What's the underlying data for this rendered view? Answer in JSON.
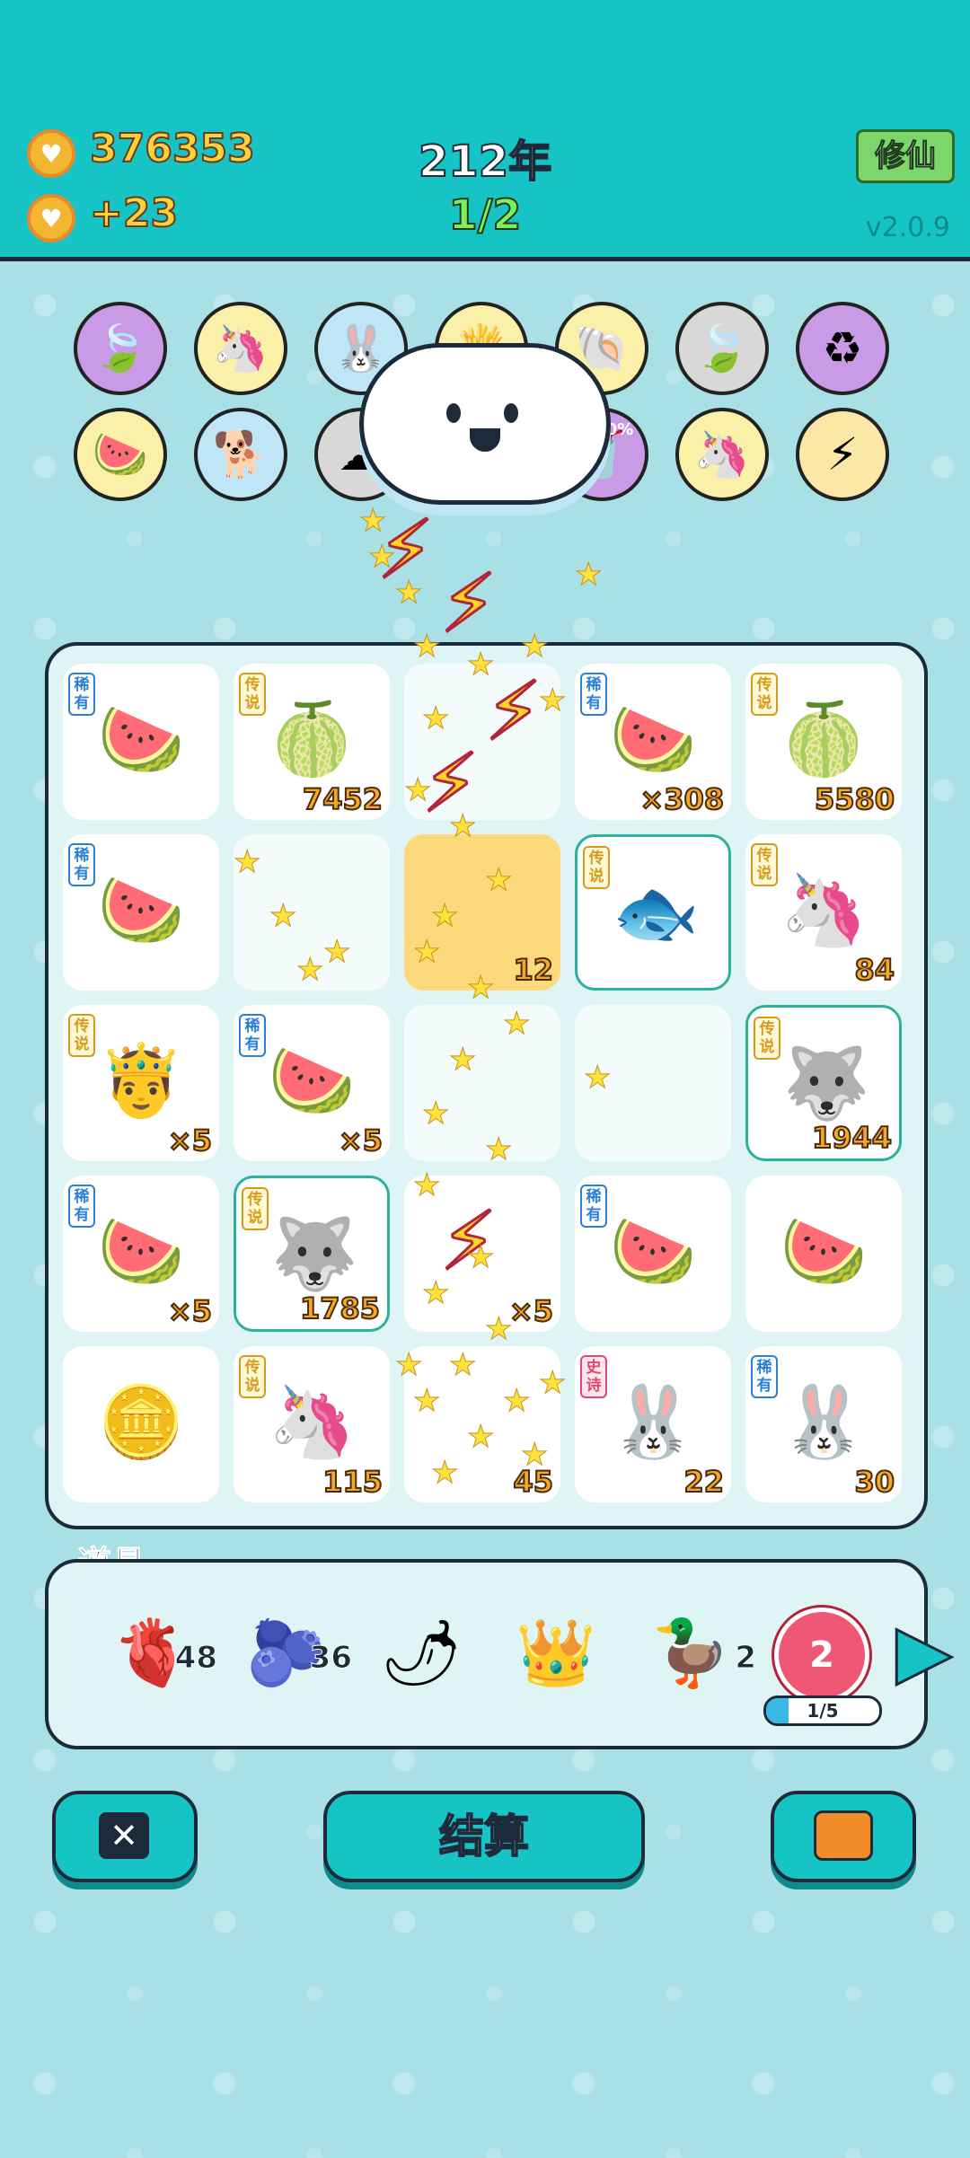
{
  "header": {
    "coins": "376353",
    "coins_rate": "+23",
    "year": "212年",
    "round": "1/2",
    "mode_button": "修仙",
    "version": "v2.0.9"
  },
  "upgrades": [
    {
      "icon": "leaf-icon",
      "glyph": "🍃"
    },
    {
      "icon": "unicorn-icon",
      "glyph": "🦄"
    },
    {
      "icon": "rabbit-icon",
      "glyph": "🐰"
    },
    {
      "icon": "fries-icon",
      "glyph": "🍟"
    },
    {
      "icon": "shell-icon",
      "glyph": "🐚"
    },
    {
      "icon": "leaf-icon",
      "glyph": "🍃"
    },
    {
      "icon": "recycle-icon",
      "glyph": "♻"
    },
    {
      "icon": "fruit-basket-icon",
      "glyph": "🍉"
    },
    {
      "icon": "dog-icon",
      "glyph": "🐕"
    },
    {
      "icon": "cloud-icon",
      "glyph": "☁"
    },
    {
      "icon": "alert-icon",
      "glyph": "⚠"
    },
    {
      "icon": "juice-icon",
      "glyph": "🥤",
      "label": "+100%"
    },
    {
      "icon": "unicorn-icon",
      "glyph": "🦄"
    },
    {
      "icon": "lightning-icon",
      "glyph": "⚡"
    }
  ],
  "board": {
    "cells": [
      {
        "tag": "稀有",
        "tagColor": "blue",
        "glyph": "🍉",
        "icon": "watermelon-slice-icon",
        "count": ""
      },
      {
        "tag": "传说",
        "tagColor": "gold",
        "glyph": "🍈",
        "icon": "watermelon-icon",
        "count": "7452"
      },
      {
        "tag": "",
        "tagColor": "",
        "glyph": "",
        "icon": "",
        "count": ""
      },
      {
        "tag": "稀有",
        "tagColor": "blue",
        "glyph": "🍉",
        "icon": "watermelon-slice-icon",
        "count": "×308"
      },
      {
        "tag": "传说",
        "tagColor": "gold",
        "glyph": "🍈",
        "icon": "watermelon-icon",
        "count": "5580"
      },
      {
        "tag": "稀有",
        "tagColor": "blue",
        "glyph": "🍉",
        "icon": "watermelon-slice-icon",
        "count": ""
      },
      {
        "tag": "",
        "tagColor": "",
        "glyph": "",
        "icon": "",
        "count": ""
      },
      {
        "tag": "",
        "tagColor": "",
        "glyph": "",
        "icon": "",
        "count": "12",
        "gold": true
      },
      {
        "tag": "传说",
        "tagColor": "gold",
        "glyph": "🐟",
        "icon": "koi-fish-icon",
        "count": "",
        "hl": true
      },
      {
        "tag": "传说",
        "tagColor": "gold",
        "glyph": "🦄",
        "icon": "unicorn-icon",
        "count": "84"
      },
      {
        "tag": "传说",
        "tagColor": "gold",
        "glyph": "🤴",
        "icon": "king-icon",
        "count": "×5"
      },
      {
        "tag": "稀有",
        "tagColor": "blue",
        "glyph": "🍉",
        "icon": "watermelon-slice-icon",
        "count": "×5"
      },
      {
        "tag": "",
        "tagColor": "",
        "glyph": "",
        "icon": "",
        "count": ""
      },
      {
        "tag": "",
        "tagColor": "",
        "glyph": "",
        "icon": "",
        "count": ""
      },
      {
        "tag": "传说",
        "tagColor": "gold",
        "glyph": "🐺",
        "icon": "husky-king-icon",
        "count": "1944",
        "hl": true
      },
      {
        "tag": "稀有",
        "tagColor": "blue",
        "glyph": "🍉",
        "icon": "watermelon-slice-icon",
        "count": "×5"
      },
      {
        "tag": "传说",
        "tagColor": "gold",
        "glyph": "🐺",
        "icon": "husky-king-icon",
        "count": "1785",
        "hl": true
      },
      {
        "tag": "",
        "tagColor": "",
        "glyph": "",
        "icon": "",
        "count": "×5"
      },
      {
        "tag": "稀有",
        "tagColor": "blue",
        "glyph": "🍉",
        "icon": "watermelon-slice-icon",
        "count": ""
      },
      {
        "tag": "",
        "tagColor": "",
        "glyph": "🍉",
        "icon": "watermelon-slice-icon",
        "count": ""
      },
      {
        "tag": "",
        "tagColor": "",
        "glyph": "🪙",
        "icon": "coin-pile-icon",
        "count": ""
      },
      {
        "tag": "传说",
        "tagColor": "gold",
        "glyph": "🦄",
        "icon": "unicorn-icon",
        "count": "115"
      },
      {
        "tag": "",
        "tagColor": "",
        "glyph": "",
        "icon": "",
        "count": "45"
      },
      {
        "tag": "史诗",
        "tagColor": "red",
        "glyph": "🐰",
        "icon": "rabbit-house-icon",
        "count": "22"
      },
      {
        "tag": "稀有",
        "tagColor": "blue",
        "glyph": "🐰",
        "icon": "rabbit-icon",
        "count": "30"
      }
    ]
  },
  "props": {
    "label": "道具",
    "items": [
      {
        "icon": "liver-icon",
        "glyph": "🫀",
        "count": "48"
      },
      {
        "icon": "blueberry-icon",
        "glyph": "🫐",
        "count": "36"
      },
      {
        "icon": "chili-icon",
        "glyph": "🌶",
        "count": ""
      },
      {
        "icon": "crown-icon",
        "glyph": "👑",
        "count": ""
      },
      {
        "icon": "duck-icon",
        "glyph": "🦆",
        "count": "2"
      }
    ],
    "target_value": "2",
    "progress_text": "1/5",
    "progress": 0.2
  },
  "buttons": {
    "settle": "结算"
  }
}
